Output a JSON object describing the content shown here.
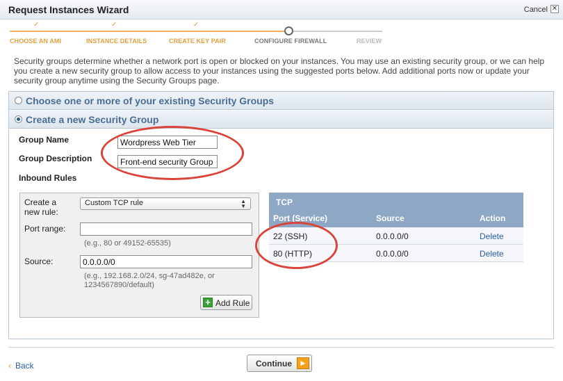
{
  "window": {
    "title": "Request Instances Wizard",
    "cancel_label": "Cancel",
    "close_glyph": "✕"
  },
  "steps": [
    {
      "label": "CHOOSE AN AMI",
      "state": "done"
    },
    {
      "label": "INSTANCE DETAILS",
      "state": "done"
    },
    {
      "label": "CREATE KEY PAIR",
      "state": "done"
    },
    {
      "label": "CONFIGURE FIREWALL",
      "state": "current"
    },
    {
      "label": "REVIEW",
      "state": "future"
    }
  ],
  "step_check_glyph": "✓",
  "intro_text": "Security groups determine whether a network port is open or blocked on your instances. You may use an existing security group, or we can help you create a new security group to allow access to your instances using the suggested ports below. Add additional ports now or update your security group anytime using the Security Groups page.",
  "options": {
    "existing_label": "Choose one or more of your existing Security Groups",
    "existing_selected": false,
    "new_label": "Create a new Security Group",
    "new_selected": true
  },
  "form": {
    "group_name_label": "Group Name",
    "group_name_value": "Wordpress Web Tier",
    "group_description_label": "Group Description",
    "group_description_value": "Front-end security Group",
    "inbound_rules_label": "Inbound Rules"
  },
  "rule_builder": {
    "create_rule_label_1": "Create a",
    "create_rule_label_2": "new rule:",
    "rule_type_selected": "Custom TCP rule",
    "port_range_label": "Port range:",
    "port_range_value": "",
    "port_range_hint": "(e.g., 80 or 49152-65535)",
    "source_label": "Source:",
    "source_value": "0.0.0.0/0",
    "source_hint_1": "(e.g., 192.168.2.0/24, sg-47ad482e, or",
    "source_hint_2": "1234567890/default)",
    "add_rule_label": "Add Rule",
    "add_rule_icon": "+"
  },
  "tcp_table": {
    "title": "TCP",
    "columns": [
      "Port (Service)",
      "Source",
      "Action"
    ],
    "rows": [
      {
        "port": "22 (SSH)",
        "source": "0.0.0.0/0",
        "action": "Delete"
      },
      {
        "port": "80 (HTTP)",
        "source": "0.0.0.0/0",
        "action": "Delete"
      }
    ]
  },
  "footer": {
    "back_chevron": "‹",
    "back_label": "Back",
    "continue_label": "Continue",
    "continue_icon": "▶"
  },
  "colors": {
    "annotation_red": "#d9453b",
    "step_done": "#e39f3c",
    "table_header": "#8ea7c4",
    "link_blue": "#2a5fa8"
  }
}
